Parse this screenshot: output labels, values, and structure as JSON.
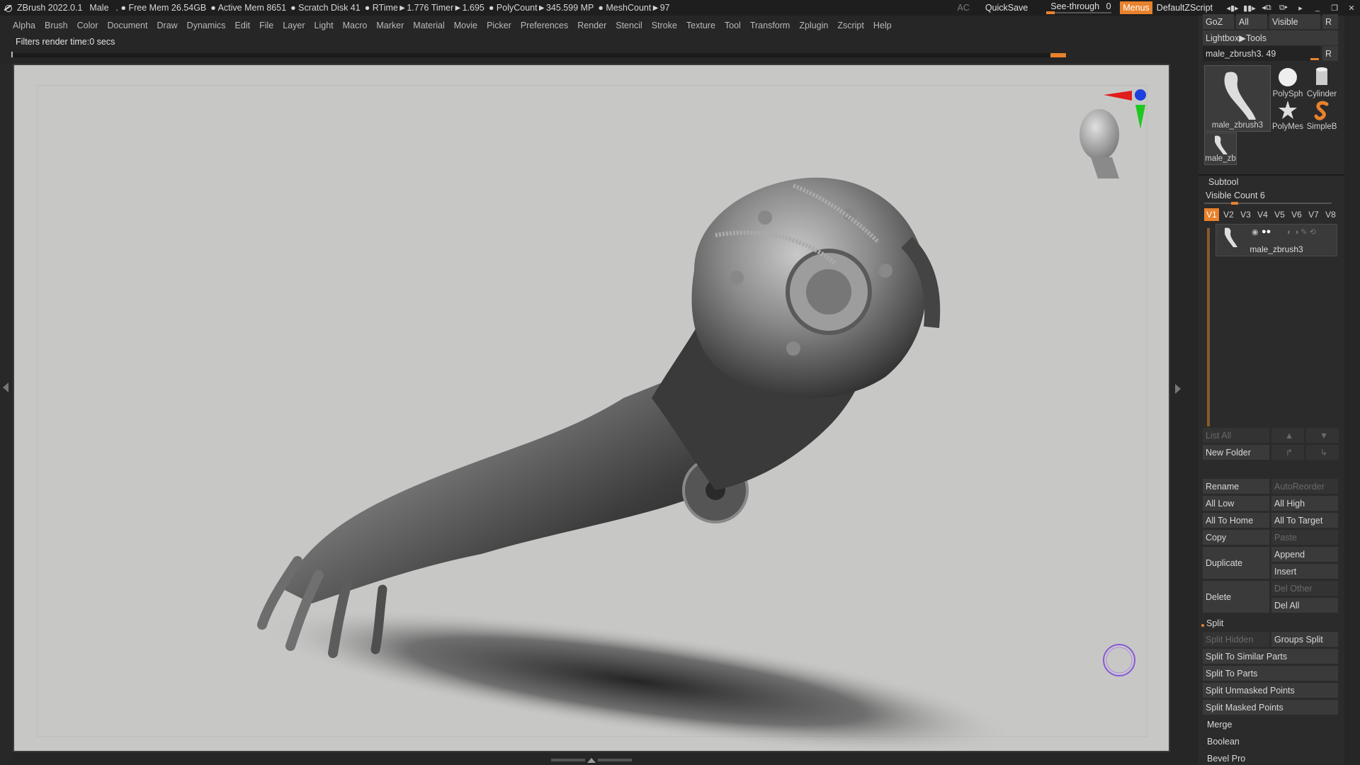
{
  "titlebar": {
    "app": "ZBrush 2022.0.1",
    "doc": "Male",
    "status": [
      ". ● Free Mem 26.54GB",
      "● Active Mem 8651",
      "● Scratch Disk 41",
      "● RTime►1.776 Timer►1.695",
      "● PolyCount►345.599 MP",
      "● MeshCount►97"
    ],
    "ac": "AC",
    "quicksave": "QuickSave",
    "see_through_label": "See-through",
    "see_through_value": "0",
    "menus": "Menus",
    "script": "DefaultZScript",
    "icons": [
      "layout-1-icon",
      "layout-2-icon",
      "layout-3-icon",
      "layout-4-icon",
      "restore-icon",
      "minimize-icon",
      "maximize-icon",
      "close-icon"
    ],
    "accent": "#e8822c"
  },
  "menubar": {
    "items": [
      "Alpha",
      "Brush",
      "Color",
      "Document",
      "Draw",
      "Dynamics",
      "Edit",
      "File",
      "Layer",
      "Light",
      "Macro",
      "Marker",
      "Material",
      "Movie",
      "Picker",
      "Preferences",
      "Render",
      "Stencil",
      "Stroke",
      "Texture",
      "Tool",
      "Transform",
      "Zplugin",
      "Zscript",
      "Help"
    ]
  },
  "note": "Filters render time:0 secs",
  "panel": {
    "top_buttons": [
      "GoZ",
      "All",
      "Visible",
      "R"
    ],
    "lightbox": "Lightbox▶Tools",
    "tool_slider_label": "male_zbrush3. 49",
    "tool_slider_r": "R",
    "tools": {
      "main_caption": "male_zbrush3",
      "polysphere": "PolySph",
      "cylinder": "Cylinder",
      "polymesh": "PolyMes",
      "simpleb": "SimpleB",
      "small_caption": "male_zb"
    },
    "subtool_title": "Subtool",
    "visible_count_label": "Visible Count",
    "visible_count_value": "6",
    "versions": [
      "V1",
      "V2",
      "V3",
      "V4",
      "V5",
      "V6",
      "V7",
      "V8"
    ],
    "subtool_item": "male_zbrush3",
    "list_all": "List All",
    "new_folder": "New Folder",
    "rename": "Rename",
    "autoreorder": "AutoReorder",
    "all_low": "All Low",
    "all_high": "All High",
    "all_to_home": "All To Home",
    "all_to_target": "All To Target",
    "copy": "Copy",
    "paste": "Paste",
    "duplicate": "Duplicate",
    "append": "Append",
    "insert": "Insert",
    "delete": "Delete",
    "del_other": "Del Other",
    "del_all": "Del All",
    "split_title": "Split",
    "split_hidden": "Split Hidden",
    "groups_split": "Groups Split",
    "split_similar": "Split To Similar Parts",
    "split_parts": "Split To Parts",
    "split_unmasked": "Split Unmasked Points",
    "split_masked": "Split Masked Points",
    "merge": "Merge",
    "boolean": "Boolean",
    "bevel_pro": "Bevel Pro"
  }
}
